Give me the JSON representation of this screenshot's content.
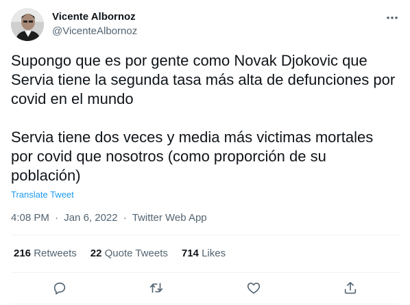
{
  "author": {
    "name": "Vicente Albornoz",
    "handle": "@VicenteAlbornoz"
  },
  "tweet": {
    "paragraph_1": "Supongo que es por gente como Novak Djokovic que Servia tiene la segunda tasa más alta de defunciones por covid en el mundo",
    "paragraph_2": "Servia tiene dos veces y media más victimas mortales por covid que nosotros (como proporción de su población)",
    "translate_label": "Translate Tweet"
  },
  "meta": {
    "time": "4:08 PM",
    "separator": "·",
    "date": "Jan 6, 2022",
    "source": "Twitter Web App"
  },
  "stats": {
    "retweets_count": "216",
    "retweets_label": "Retweets",
    "quotes_count": "22",
    "quotes_label": "Quote Tweets",
    "likes_count": "714",
    "likes_label": "Likes"
  },
  "icons": {
    "more": "more-dots-icon",
    "reply": "reply-bubble-icon",
    "retweet": "retweet-arrows-icon",
    "like": "heart-icon",
    "share": "share-upload-icon"
  },
  "colors": {
    "text": "#0f1419",
    "secondary": "#536471",
    "link": "#1d9bf0",
    "divider": "#eff3f4"
  }
}
